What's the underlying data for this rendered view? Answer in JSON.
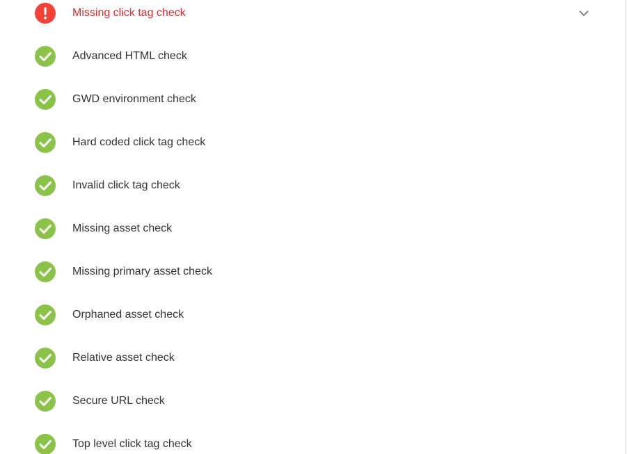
{
  "colors": {
    "pass": "#8bc34a",
    "fail": "#f44336",
    "fail_text": "#d32f2f",
    "text": "#333333"
  },
  "checks": [
    {
      "label": "Missing click tag check",
      "status": "fail",
      "icon": "error-icon",
      "expandable": true,
      "expand_icon": "chevron-down-icon"
    },
    {
      "label": "Advanced HTML check",
      "status": "pass",
      "icon": "check-circle-icon"
    },
    {
      "label": "GWD environment check",
      "status": "pass",
      "icon": "check-circle-icon"
    },
    {
      "label": "Hard coded click tag check",
      "status": "pass",
      "icon": "check-circle-icon"
    },
    {
      "label": "Invalid click tag check",
      "status": "pass",
      "icon": "check-circle-icon"
    },
    {
      "label": "Missing asset check",
      "status": "pass",
      "icon": "check-circle-icon"
    },
    {
      "label": "Missing primary asset check",
      "status": "pass",
      "icon": "check-circle-icon"
    },
    {
      "label": "Orphaned asset check",
      "status": "pass",
      "icon": "check-circle-icon"
    },
    {
      "label": "Relative asset check",
      "status": "pass",
      "icon": "check-circle-icon"
    },
    {
      "label": "Secure URL check",
      "status": "pass",
      "icon": "check-circle-icon"
    },
    {
      "label": "Top level click tag check",
      "status": "pass",
      "icon": "check-circle-icon"
    }
  ]
}
